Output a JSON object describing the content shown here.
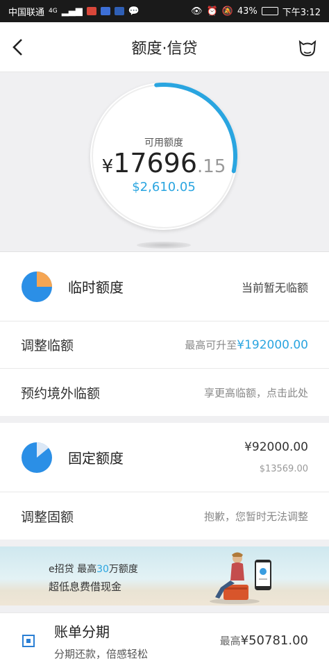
{
  "status_bar": {
    "carrier": "中国联通",
    "network": "4G",
    "battery": "43%",
    "time": "下午3:12"
  },
  "nav": {
    "title": "额度·信贷"
  },
  "hero": {
    "label": "可用额度",
    "currency": "¥",
    "amount_int": "17696",
    "amount_dec": ".15",
    "usd": "$2,610.05",
    "arc_fraction": 0.25,
    "accent_color": "#2aa5e0"
  },
  "temp_limit": {
    "title": "临时额度",
    "status": "当前暂无临额"
  },
  "adjust_temp": {
    "title": "调整临额",
    "prefix": "最高可升至",
    "value": "¥192000.00"
  },
  "overseas": {
    "title": "预约境外临额",
    "hint": "享更高临额，点击此处"
  },
  "fixed_limit": {
    "title": "固定额度",
    "cny": "¥92000.00",
    "usd": "$13569.00"
  },
  "adjust_fixed": {
    "title": "调整固额",
    "hint": "抱歉，您暂时无法调整"
  },
  "banner": {
    "line1_prefix": "e招贷  最高",
    "line1_highlight": "30",
    "line1_suffix": "万额度",
    "line2": "超低息费借现金"
  },
  "installment": {
    "title": "账单分期",
    "subtitle": "分期还款，倍感轻松",
    "prefix": "最高",
    "value": "¥50781.00"
  }
}
